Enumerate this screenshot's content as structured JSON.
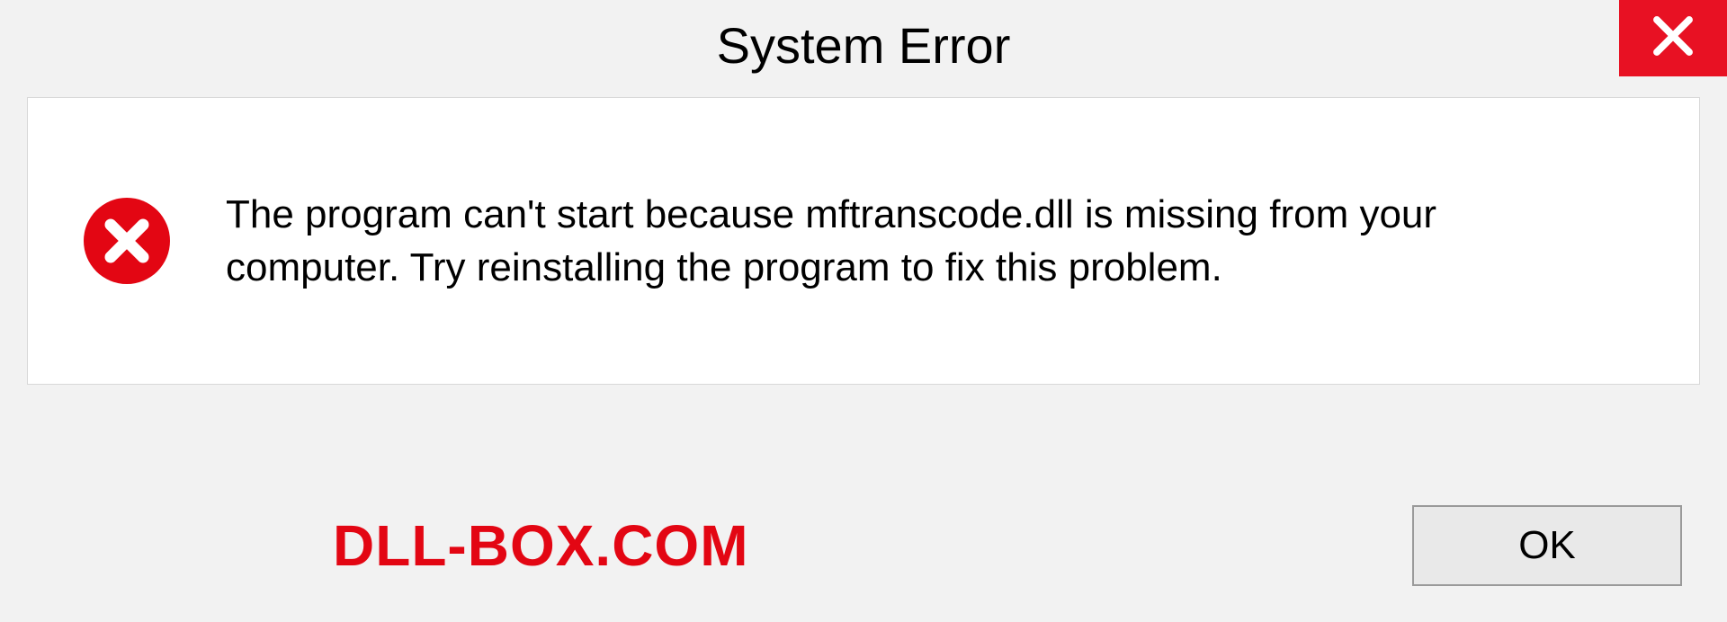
{
  "dialog": {
    "title": "System Error",
    "message": "The program can't start because mftranscode.dll is missing from your computer. Try reinstalling the program to fix this problem.",
    "ok_label": "OK"
  },
  "watermark": {
    "text": "DLL-BOX.COM"
  },
  "colors": {
    "close_bg": "#e81123",
    "error_icon": "#e30613",
    "watermark": "#e30613"
  }
}
